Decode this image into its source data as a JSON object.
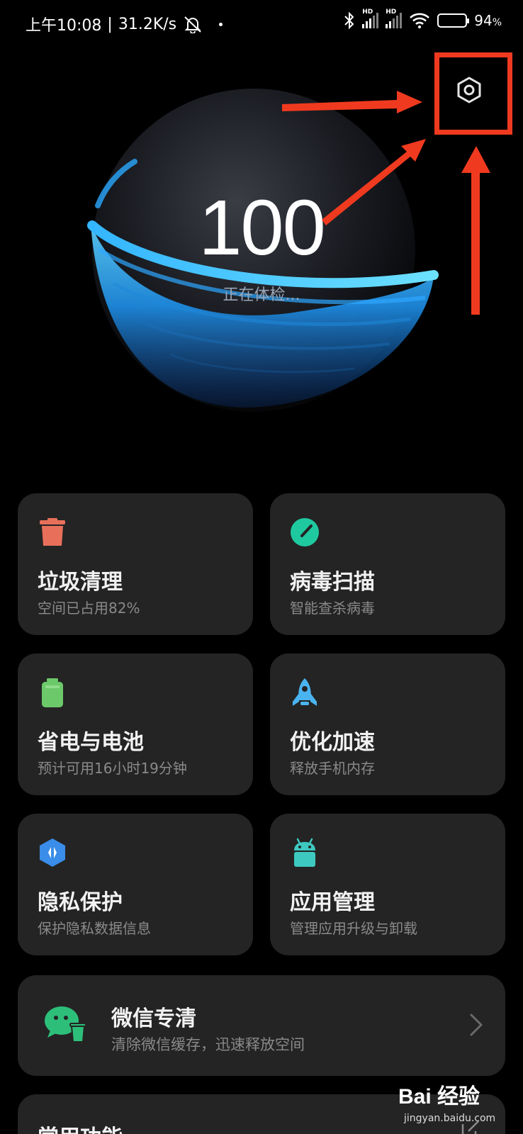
{
  "status_bar": {
    "time": "上午10:08",
    "network_speed": "31.2K/s",
    "battery_percent": "94",
    "battery_level": 0.94,
    "hd_label": "HD"
  },
  "header": {
    "settings_icon": "gear-hexagon-icon"
  },
  "hero": {
    "score": "100",
    "status": "正在体检..."
  },
  "cards": [
    {
      "title": "垃圾清理",
      "subtitle": "空间已占用82%",
      "icon": "trash-can-icon",
      "color": "#e8705a"
    },
    {
      "title": "病毒扫描",
      "subtitle": "智能查杀病毒",
      "icon": "virus-scan-icon",
      "color": "#1fc9a0"
    },
    {
      "title": "省电与电池",
      "subtitle": "预计可用16小时19分钟",
      "icon": "battery-icon",
      "color": "#6cc96a"
    },
    {
      "title": "优化加速",
      "subtitle": "释放手机内存",
      "icon": "rocket-icon",
      "color": "#4ab4f0"
    },
    {
      "title": "隐私保护",
      "subtitle": "保护隐私数据信息",
      "icon": "privacy-shield-icon",
      "color": "#3a8de8"
    },
    {
      "title": "应用管理",
      "subtitle": "管理应用升级与卸载",
      "icon": "android-icon",
      "color": "#3dc9c0"
    }
  ],
  "wechat": {
    "title": "微信专清",
    "subtitle": "清除微信缓存，迅速释放空间",
    "icon": "wechat-clean-icon",
    "color": "#2dbf7a"
  },
  "common": {
    "title": "常用功能",
    "icon": "edit-icon"
  },
  "watermark": {
    "logo": "Bai 经验",
    "url": "jingyan.baidu.com"
  },
  "colors": {
    "annotation": "#f03a1f",
    "card_bg": "#242424",
    "sphere_glow": "#2aa9ff"
  }
}
